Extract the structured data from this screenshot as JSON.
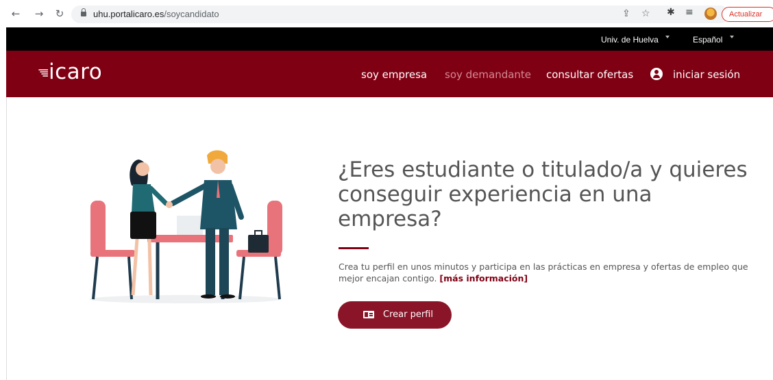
{
  "browser": {
    "url_host": "uhu.portalicaro.es",
    "url_path": "/soycandidato",
    "update_label": "Actualizar"
  },
  "topbar": {
    "university": "Univ. de Huelva",
    "language": "Español"
  },
  "header": {
    "logo": "icaro",
    "nav": {
      "empresa": "soy empresa",
      "demandante": "soy demandante",
      "ofertas": "consultar ofertas",
      "login": "iniciar sesión"
    }
  },
  "main": {
    "headline": "¿Eres estudiante o titulado/a y quieres conseguir experiencia en una empresa?",
    "description": "Crea tu perfil en unos minutos y participa en las prácticas en empresa y ofertas de empleo que mejor encajan contigo.",
    "more_info": "[más información]",
    "cta": "Crear perfil"
  },
  "colors": {
    "brand": "#800013",
    "active_link": "#d48a96",
    "topbar": "#000000"
  }
}
